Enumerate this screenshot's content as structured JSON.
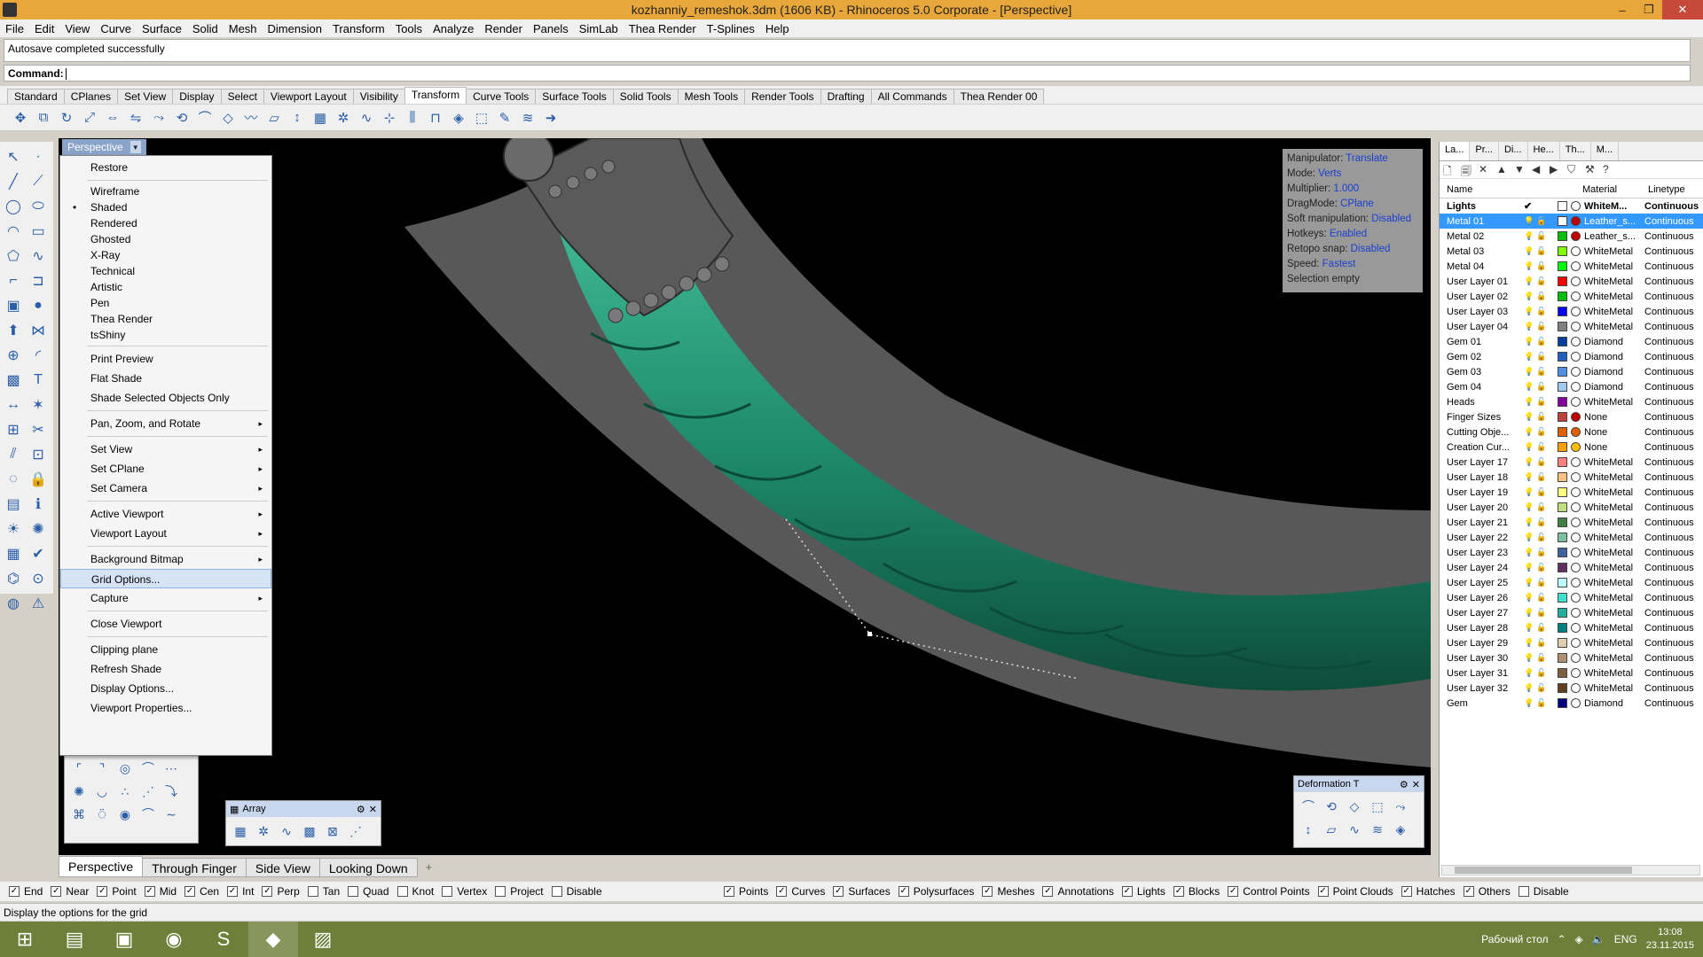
{
  "window": {
    "title": "kozhanniy_remeshok.3dm (1606 KB) - Rhinoceros  5.0 Corporate - [Perspective]",
    "minimize": "–",
    "restore": "❐",
    "close": "✕"
  },
  "menubar": [
    "File",
    "Edit",
    "View",
    "Curve",
    "Surface",
    "Solid",
    "Mesh",
    "Dimension",
    "Transform",
    "Tools",
    "Analyze",
    "Render",
    "Panels",
    "SimLab",
    "Thea Render",
    "T-Splines",
    "Help"
  ],
  "command": {
    "history": "Autosave completed successfully",
    "prompt": "Command:"
  },
  "toolbar_tabs": [
    "Standard",
    "CPlanes",
    "Set View",
    "Display",
    "Select",
    "Viewport Layout",
    "Visibility",
    "Transform",
    "Curve Tools",
    "Surface Tools",
    "Solid Tools",
    "Mesh Tools",
    "Render Tools",
    "Drafting",
    "All Commands",
    "Thea Render 00"
  ],
  "active_toolbar_tab": "Transform",
  "viewport": {
    "name": "Perspective",
    "dropdown": "▼"
  },
  "context_menu": {
    "restore": "Restore",
    "display_modes": [
      "Wireframe",
      "Shaded",
      "Rendered",
      "Ghosted",
      "X-Ray",
      "Technical",
      "Artistic",
      "Pen",
      "Thea Render",
      "tsShiny"
    ],
    "checked_mode": "Shaded",
    "print_preview": "Print Preview",
    "flat_shade": "Flat Shade",
    "shade_selected": "Shade Selected Objects Only",
    "pan_zoom": "Pan, Zoom, and Rotate",
    "set_view": "Set View",
    "set_cplane": "Set CPlane",
    "set_camera": "Set Camera",
    "active_viewport": "Active Viewport",
    "viewport_layout": "Viewport Layout",
    "background_bitmap": "Background Bitmap",
    "grid_options": "Grid Options...",
    "capture": "Capture",
    "close_viewport": "Close Viewport",
    "clipping_plane": "Clipping plane",
    "refresh_shade": "Refresh Shade",
    "display_options": "Display Options...",
    "viewport_properties": "Viewport Properties...",
    "submenu_arrow": "▸",
    "bullet": "•"
  },
  "hud": [
    {
      "label": "Manipulator:",
      "value": "Translate"
    },
    {
      "label": "Mode:",
      "value": "Verts"
    },
    {
      "label": "Multiplier:",
      "value": "1.000"
    },
    {
      "label": "DragMode:",
      "value": "CPlane"
    },
    {
      "label": "Soft manipulation:",
      "value": "Disabled"
    },
    {
      "label": "Hotkeys:",
      "value": "Enabled"
    },
    {
      "label": "Retopo snap:",
      "value": "Disabled"
    },
    {
      "label": "Speed:",
      "value": "Fastest"
    },
    {
      "label": "Selection empty",
      "value": ""
    }
  ],
  "array_panel": {
    "title": "Array",
    "gear": "⚙",
    "close": "✕"
  },
  "deformation_panel": {
    "title": "Deformation T",
    "gear": "⚙",
    "close": "✕"
  },
  "view_tabs": [
    "Perspective",
    "Through Finger",
    "Side View",
    "Looking Down"
  ],
  "view_tab_add": "+",
  "osnaps": [
    {
      "label": "End",
      "checked": true
    },
    {
      "label": "Near",
      "checked": true
    },
    {
      "label": "Point",
      "checked": true
    },
    {
      "label": "Mid",
      "checked": true
    },
    {
      "label": "Cen",
      "checked": true
    },
    {
      "label": "Int",
      "checked": true
    },
    {
      "label": "Perp",
      "checked": true
    },
    {
      "label": "Tan",
      "checked": false
    },
    {
      "label": "Quad",
      "checked": false
    },
    {
      "label": "Knot",
      "checked": false
    },
    {
      "label": "Vertex",
      "checked": false
    },
    {
      "label": "Project",
      "checked": false
    },
    {
      "label": "Disable",
      "checked": false
    }
  ],
  "selection_filters": [
    {
      "label": "Points",
      "checked": true
    },
    {
      "label": "Curves",
      "checked": true
    },
    {
      "label": "Surfaces",
      "checked": true
    },
    {
      "label": "Polysurfaces",
      "checked": true
    },
    {
      "label": "Meshes",
      "checked": true
    },
    {
      "label": "Annotations",
      "checked": true
    },
    {
      "label": "Lights",
      "checked": true
    },
    {
      "label": "Blocks",
      "checked": true
    },
    {
      "label": "Control Points",
      "checked": true
    },
    {
      "label": "Point Clouds",
      "checked": true
    },
    {
      "label": "Hatches",
      "checked": true
    },
    {
      "label": "Others",
      "checked": true
    },
    {
      "label": "Disable",
      "checked": false
    }
  ],
  "check_glyph": "✓",
  "status": "Display the options for the grid",
  "panel_tabs": [
    "La...",
    "Pr...",
    "Di...",
    "He...",
    "Th...",
    "M..."
  ],
  "layers_header": {
    "name": "Name",
    "material": "Material",
    "linetype": "Linetype"
  },
  "layers": [
    {
      "name": "Lights",
      "color": "#ffffff",
      "material": "WhiteM...",
      "matColor": "#ffffff",
      "linetype": "Continuous",
      "current": true
    },
    {
      "name": "Metal 01",
      "color": "#ffffff",
      "material": "Leather_s...",
      "matColor": "#c00000",
      "linetype": "Continuous",
      "selected": true
    },
    {
      "name": "Metal 02",
      "color": "#00c000",
      "material": "Leather_s...",
      "matColor": "#c00000",
      "linetype": "Continuous"
    },
    {
      "name": "Metal 03",
      "color": "#7fff00",
      "material": "WhiteMetal",
      "matColor": "#ffffff",
      "linetype": "Continuous"
    },
    {
      "name": "Metal 04",
      "color": "#00ff00",
      "material": "WhiteMetal",
      "matColor": "#ffffff",
      "linetype": "Continuous"
    },
    {
      "name": "User Layer 01",
      "color": "#ff0000",
      "material": "WhiteMetal",
      "matColor": "#ffffff",
      "linetype": "Continuous"
    },
    {
      "name": "User Layer 02",
      "color": "#00c000",
      "material": "WhiteMetal",
      "matColor": "#ffffff",
      "linetype": "Continuous"
    },
    {
      "name": "User Layer 03",
      "color": "#0000ff",
      "material": "WhiteMetal",
      "matColor": "#ffffff",
      "linetype": "Continuous"
    },
    {
      "name": "User Layer 04",
      "color": "#808080",
      "material": "WhiteMetal",
      "matColor": "#ffffff",
      "linetype": "Continuous"
    },
    {
      "name": "Gem 01",
      "color": "#003fa0",
      "material": "Diamond",
      "matColor": "#ffffff",
      "linetype": "Continuous"
    },
    {
      "name": "Gem 02",
      "color": "#2060c0",
      "material": "Diamond",
      "matColor": "#ffffff",
      "linetype": "Continuous"
    },
    {
      "name": "Gem 03",
      "color": "#5090e0",
      "material": "Diamond",
      "matColor": "#ffffff",
      "linetype": "Continuous"
    },
    {
      "name": "Gem 04",
      "color": "#a0c8f0",
      "material": "Diamond",
      "matColor": "#ffffff",
      "linetype": "Continuous"
    },
    {
      "name": "Heads",
      "color": "#8000a0",
      "material": "WhiteMetal",
      "matColor": "#ffffff",
      "linetype": "Continuous"
    },
    {
      "name": "Finger Sizes",
      "color": "#c04040",
      "material": "None",
      "matColor": "#c00000",
      "linetype": "Continuous"
    },
    {
      "name": "Cutting Obje...",
      "color": "#e06000",
      "material": "None",
      "matColor": "#e06000",
      "linetype": "Continuous"
    },
    {
      "name": "Creation Cur...",
      "color": "#ffa000",
      "material": "None",
      "matColor": "#ffc000",
      "linetype": "Continuous"
    },
    {
      "name": "User Layer 17",
      "color": "#ff8080",
      "material": "WhiteMetal",
      "matColor": "#ffffff",
      "linetype": "Continuous"
    },
    {
      "name": "User Layer 18",
      "color": "#ffc080",
      "material": "WhiteMetal",
      "matColor": "#ffffff",
      "linetype": "Continuous"
    },
    {
      "name": "User Layer 19",
      "color": "#ffff80",
      "material": "WhiteMetal",
      "matColor": "#ffffff",
      "linetype": "Continuous"
    },
    {
      "name": "User Layer 20",
      "color": "#c0e080",
      "material": "WhiteMetal",
      "matColor": "#ffffff",
      "linetype": "Continuous"
    },
    {
      "name": "User Layer 21",
      "color": "#408040",
      "material": "WhiteMetal",
      "matColor": "#ffffff",
      "linetype": "Continuous"
    },
    {
      "name": "User Layer 22",
      "color": "#80c0a0",
      "material": "WhiteMetal",
      "matColor": "#ffffff",
      "linetype": "Continuous"
    },
    {
      "name": "User Layer 23",
      "color": "#4060a0",
      "material": "WhiteMetal",
      "matColor": "#ffffff",
      "linetype": "Continuous"
    },
    {
      "name": "User Layer 24",
      "color": "#603060",
      "material": "WhiteMetal",
      "matColor": "#ffffff",
      "linetype": "Continuous"
    },
    {
      "name": "User Layer 25",
      "color": "#c0ffff",
      "material": "WhiteMetal",
      "matColor": "#ffffff",
      "linetype": "Continuous"
    },
    {
      "name": "User Layer 26",
      "color": "#40e0d0",
      "material": "WhiteMetal",
      "matColor": "#ffffff",
      "linetype": "Continuous"
    },
    {
      "name": "User Layer 27",
      "color": "#20b0a0",
      "material": "WhiteMetal",
      "matColor": "#ffffff",
      "linetype": "Continuous"
    },
    {
      "name": "User Layer 28",
      "color": "#008080",
      "material": "WhiteMetal",
      "matColor": "#ffffff",
      "linetype": "Continuous"
    },
    {
      "name": "User Layer 29",
      "color": "#e0d0b0",
      "material": "WhiteMetal",
      "matColor": "#ffffff",
      "linetype": "Continuous"
    },
    {
      "name": "User Layer 30",
      "color": "#b09070",
      "material": "WhiteMetal",
      "matColor": "#ffffff",
      "linetype": "Continuous"
    },
    {
      "name": "User Layer 31",
      "color": "#806040",
      "material": "WhiteMetal",
      "matColor": "#ffffff",
      "linetype": "Continuous"
    },
    {
      "name": "User Layer 32",
      "color": "#604020",
      "material": "WhiteMetal",
      "matColor": "#ffffff",
      "linetype": "Continuous"
    },
    {
      "name": "Gem",
      "color": "#000080",
      "material": "Diamond",
      "matColor": "#ffffff",
      "linetype": "Continuous"
    }
  ],
  "taskbar": {
    "desktop_label": "Рабочий стол",
    "lang": "ENG",
    "time": "13:08",
    "date": "23.11.2015"
  },
  "colors": {
    "accent_blue": "#3399ff",
    "titlebar": "#e8a73a",
    "leather_green": "#1e8a6a",
    "taskbar": "#6e7f3a"
  }
}
